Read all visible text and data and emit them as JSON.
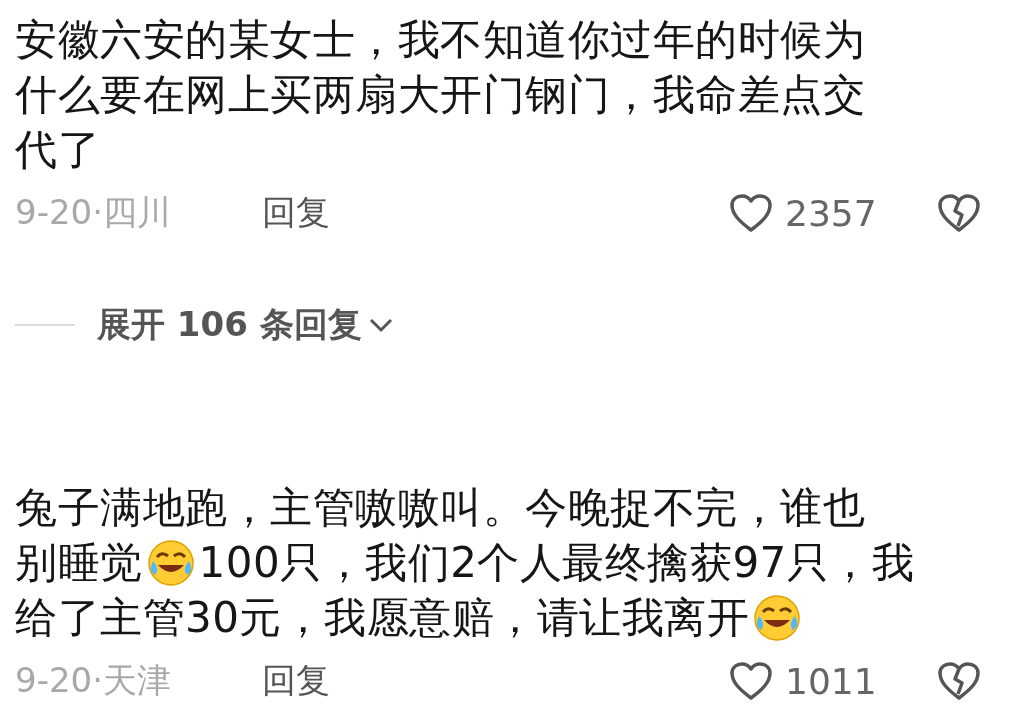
{
  "comments": [
    {
      "lines": [
        [
          {
            "kind": "text",
            "text": "安徽六安的某女士，我不知道你过年的时候为"
          }
        ],
        [
          {
            "kind": "text",
            "text": "什么要在网上买两扇大开门钢门，我命差点交"
          }
        ],
        [
          {
            "kind": "text",
            "text": "代了"
          }
        ]
      ],
      "date": "9-20·四川",
      "reply": "回复",
      "likes": "2357",
      "liked": false,
      "expand": "展开 106 条回复"
    },
    {
      "lines": [
        [
          {
            "kind": "text",
            "text": "兔子满地跑，主管嗷嗷叫。今晚捉不完，谁也"
          }
        ],
        [
          {
            "kind": "text",
            "text": "别睡觉"
          },
          {
            "kind": "emoji"
          },
          {
            "kind": "text",
            "text": "100只，我们2个人最终擒获97只，我"
          }
        ],
        [
          {
            "kind": "text",
            "text": "给了主管30元，我愿意赔，请让我离开"
          },
          {
            "kind": "emoji"
          }
        ]
      ],
      "date": "9-20·天津",
      "reply": "回复",
      "likes": "1011",
      "liked": false
    }
  ]
}
